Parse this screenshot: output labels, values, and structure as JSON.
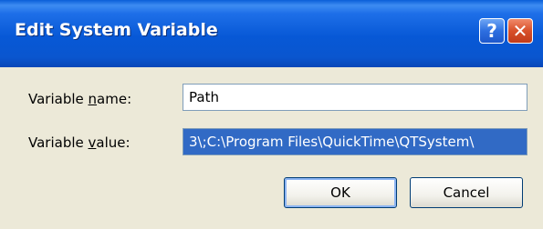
{
  "window": {
    "title": "Edit System Variable",
    "help_glyph": "?",
    "close_glyph": "✕"
  },
  "form": {
    "name_label_pre": "Variable ",
    "name_label_accel": "n",
    "name_label_post": "ame:",
    "name_value": "Path",
    "value_label_pre": "Variable ",
    "value_label_accel": "v",
    "value_label_post": "alue:",
    "value_value": "3\\;C:\\Program Files\\QuickTime\\QTSystem\\"
  },
  "buttons": {
    "ok_label": "OK",
    "cancel_label": "Cancel"
  },
  "colors": {
    "titlebar": "#0758d6",
    "selection": "#316ac5",
    "face": "#ece9d8"
  },
  "icons": {
    "help": "help-icon",
    "close": "close-icon"
  }
}
